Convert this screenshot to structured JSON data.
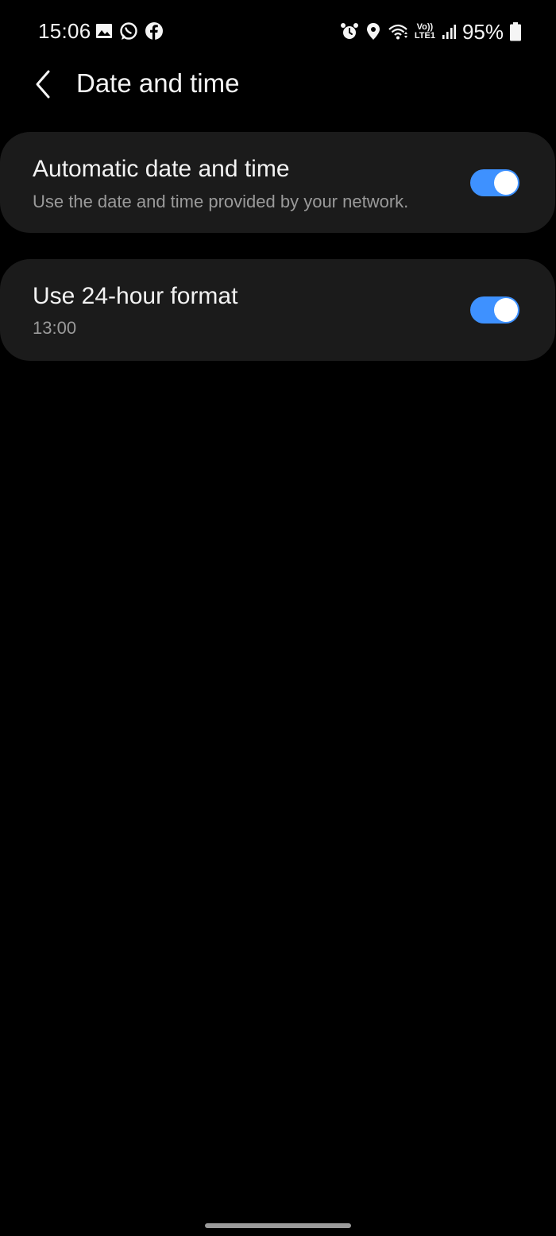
{
  "status_bar": {
    "time": "15:06",
    "left_icons": [
      "gallery-icon",
      "whatsapp-icon",
      "facebook-icon"
    ],
    "right_icons": [
      "alarm-icon",
      "location-icon",
      "wifi-icon",
      "volte-icon",
      "signal-icon",
      "battery-icon"
    ],
    "network_top": "Vo))",
    "network_bottom": "LTE1",
    "battery": "95%"
  },
  "header": {
    "back_icon": "chevron-left-icon",
    "title": "Date and time"
  },
  "settings": [
    {
      "title": "Automatic date and time",
      "subtitle": "Use the date and time provided by your network.",
      "enabled": true
    },
    {
      "title": "Use 24-hour format",
      "subtitle": "13:00",
      "enabled": true
    }
  ],
  "colors": {
    "background": "#000000",
    "card": "#1b1b1b",
    "accent": "#3e91ff",
    "subtitle": "#9a9a9a"
  }
}
